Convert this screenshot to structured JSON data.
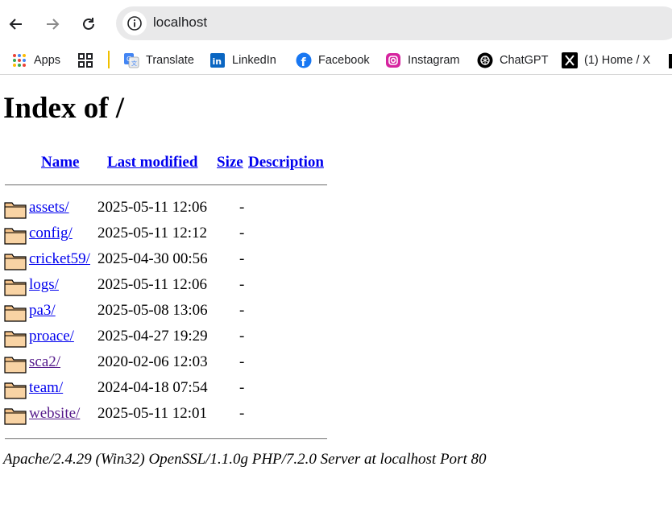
{
  "browser": {
    "url": "localhost",
    "bookmarks": [
      {
        "label": "Apps",
        "icon": "apps-grid-icon"
      },
      {
        "label": "",
        "icon": "tab-groups-icon"
      },
      {
        "label": "Translate",
        "icon": "google-translate-icon"
      },
      {
        "label": "LinkedIn",
        "icon": "linkedin-icon"
      },
      {
        "label": "Facebook",
        "icon": "facebook-icon"
      },
      {
        "label": "Instagram",
        "icon": "instagram-icon"
      },
      {
        "label": "ChatGPT",
        "icon": "chatgpt-icon"
      },
      {
        "label": "(1) Home / X",
        "icon": "x-icon"
      }
    ]
  },
  "page": {
    "title": "Index of /",
    "columns": {
      "name": "Name",
      "modified": "Last modified",
      "size": "Size",
      "description": "Description"
    },
    "entries": [
      {
        "name": "assets/",
        "modified": "2025-05-11 12:06",
        "size": "-",
        "visited": false
      },
      {
        "name": "config/",
        "modified": "2025-05-11 12:12",
        "size": "-",
        "visited": false
      },
      {
        "name": "cricket59/",
        "modified": "2025-04-30 00:56",
        "size": "-",
        "visited": false
      },
      {
        "name": "logs/",
        "modified": "2025-05-11 12:06",
        "size": "-",
        "visited": false
      },
      {
        "name": "pa3/",
        "modified": "2025-05-08 13:06",
        "size": "-",
        "visited": false
      },
      {
        "name": "proace/",
        "modified": "2025-04-27 19:29",
        "size": "-",
        "visited": false
      },
      {
        "name": "sca2/",
        "modified": "2020-02-06 12:03",
        "size": "-",
        "visited": true
      },
      {
        "name": "team/",
        "modified": "2024-04-18 07:54",
        "size": "-",
        "visited": false
      },
      {
        "name": "website/",
        "modified": "2025-05-11 12:01",
        "size": "-",
        "visited": true
      }
    ],
    "address": "Apache/2.4.29 (Win32) OpenSSL/1.1.0g PHP/7.2.0 Server at localhost Port 80"
  },
  "colors": {
    "link": "#0000ee",
    "visited": "#551a8b",
    "folder": "#f5c38a"
  }
}
